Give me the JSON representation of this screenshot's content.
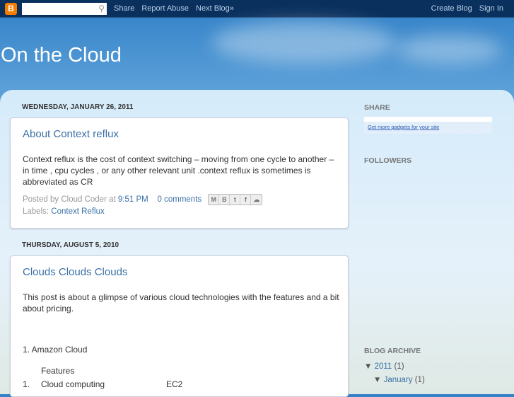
{
  "nav": {
    "search_icon": "magnifier-icon",
    "share": "Share",
    "report": "Report Abuse",
    "next": "Next Blog»",
    "create": "Create Blog",
    "signin": "Sign In"
  },
  "blog_title": "On the Cloud",
  "posts": [
    {
      "date": "WEDNESDAY, JANUARY 26, 2011",
      "title": "About Context reflux",
      "body": "Context reflux is the cost of context switching – moving from one cycle to another – in time , cpu cycles , or any other relevant unit .context reflux is sometimes is abbreviated as CR",
      "posted_by": "Posted by Cloud Coder at",
      "time": "9:51 PM",
      "comments": "0 comments",
      "labels_label": "Labels:",
      "label": "Context Reflux"
    },
    {
      "date": "THURSDAY, AUGUST 5, 2010",
      "title": "Clouds Clouds Clouds",
      "body": "This post is about a glimpse of various cloud technologies with the features and a bit about pricing.",
      "line1": "1. Amazon Cloud",
      "line2": "Features",
      "line3_num": "1.",
      "line3": "Cloud computing",
      "line3_val": "EC2"
    }
  ],
  "sidebar": {
    "share": "SHARE",
    "gadgets": "Get more gadgets for your site",
    "followers": "FOLLOWERS",
    "archive": "BLOG ARCHIVE",
    "year": "2011",
    "year_count": "(1)",
    "month": "January",
    "month_count": "(1)"
  }
}
